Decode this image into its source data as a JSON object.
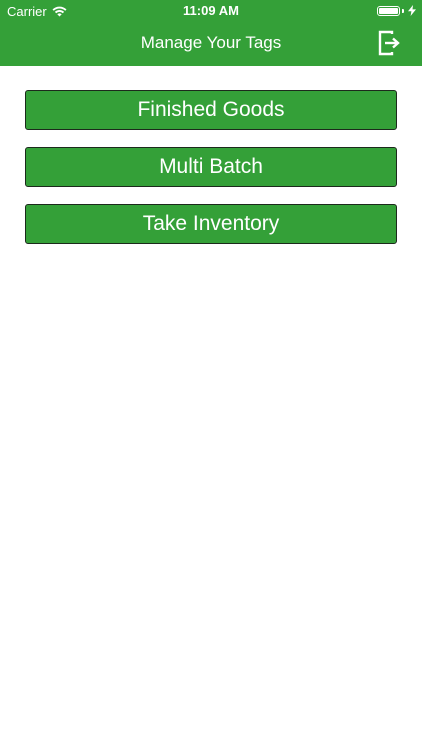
{
  "status_bar": {
    "carrier": "Carrier",
    "time": "11:09 AM",
    "battery_level": 1.0
  },
  "nav_bar": {
    "title": "Manage Your Tags",
    "logout_icon": "logout-icon"
  },
  "menu": {
    "items": [
      {
        "label": "Finished Goods"
      },
      {
        "label": "Multi Batch"
      },
      {
        "label": "Take Inventory"
      }
    ]
  },
  "colors": {
    "brand_green": "#34a038",
    "button_border": "#1c2a1c",
    "text_on_green": "#ffffff"
  }
}
